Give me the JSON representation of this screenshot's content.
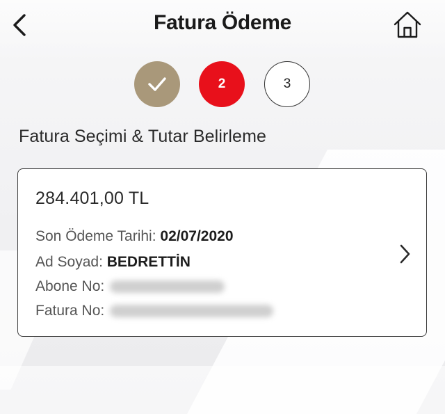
{
  "header": {
    "title": "Fatura Ödeme",
    "back_icon": "chevron-left-icon",
    "home_icon": "home-icon"
  },
  "stepper": {
    "steps": [
      {
        "label": "",
        "state": "completed",
        "icon": "check-icon",
        "color": "#a9987a"
      },
      {
        "label": "2",
        "state": "active",
        "color": "#e8101b"
      },
      {
        "label": "3",
        "state": "pending",
        "color": "#ffffff"
      }
    ]
  },
  "section": {
    "title": "Fatura Seçimi & Tutar Belirleme"
  },
  "bill": {
    "amount": "284.401,00 TL",
    "due_date_label": "Son Ödeme Tarihi:",
    "due_date_value": "02/07/2020",
    "name_label": "Ad Soyad:",
    "name_value": "BEDRETTİN",
    "subscriber_label": "Abone No:",
    "invoice_label": "Fatura No:",
    "chevron_icon": "chevron-right-icon"
  },
  "colors": {
    "accent_red": "#e8101b",
    "completed_gold": "#a9987a",
    "text_dark": "#1a1a1a"
  }
}
